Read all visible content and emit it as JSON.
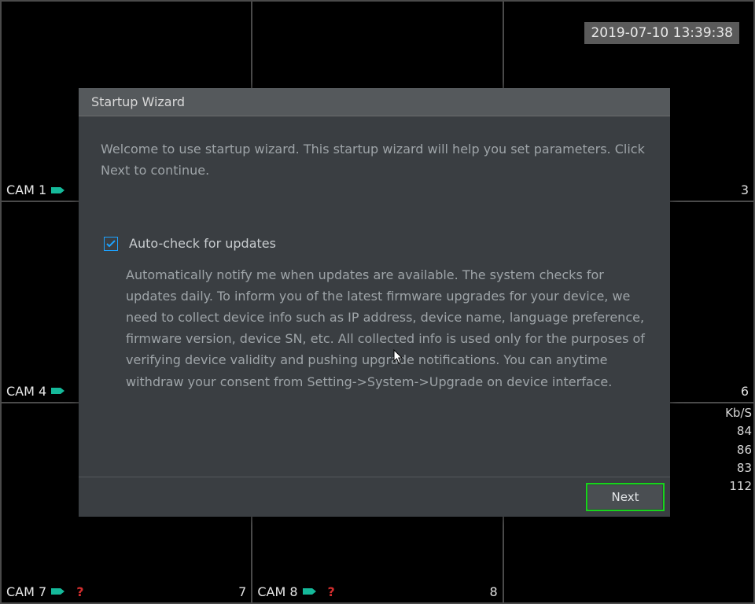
{
  "timestamp": "2019-07-10 13:39:38",
  "cameras": [
    {
      "label": "CAM 1",
      "status": "ok"
    },
    {
      "num_right": "3"
    },
    {
      "label": "CAM 4",
      "status": "ok"
    },
    {
      "num_right": "6"
    },
    {
      "label": "CAM 7",
      "status": "err",
      "num_right": "7"
    },
    {
      "label": "CAM 8",
      "status": "err",
      "num_right": "8"
    }
  ],
  "stats": {
    "header": "Kb/S",
    "rows": [
      "84",
      "86",
      "83",
      "112"
    ]
  },
  "modal": {
    "title": "Startup Wizard",
    "welcome": "Welcome to use startup wizard. This startup wizard will help you set parameters. Click Next to continue.",
    "autocheck": {
      "checked": true,
      "label": "Auto-check for updates",
      "description": "Automatically notify me when updates are available. The system checks for updates daily. To inform you of the latest firmware upgrades for your device, we need to collect device info such as IP address, device name, language preference, firmware version, device SN, etc. All collected info is used only for the purposes of verifying device validity and pushing upgrade notifications. You can anytime withdraw your consent from Setting->System->Upgrade on device interface."
    },
    "next_label": "Next"
  }
}
